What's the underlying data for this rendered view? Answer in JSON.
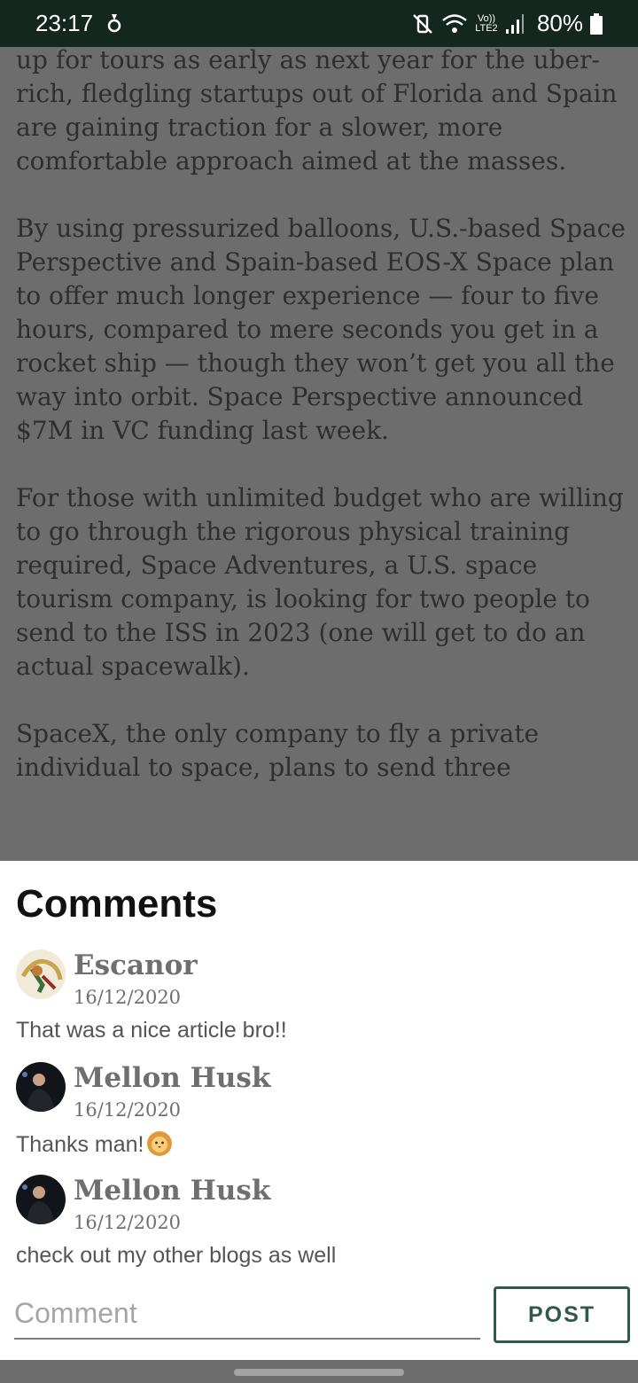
{
  "status_bar": {
    "time": "23:17",
    "network_label": "Vo)) LTE2",
    "battery": "80%"
  },
  "article": {
    "paragraphs": [
      "up for tours as early as next year for the uber-rich, fledgling startups out of Florida and Spain are gaining traction for a slower, more comfortable approach aimed at the masses.",
      "By using pressurized balloons, U.S.-based Space Perspective and Spain-based EOS-X Space plan to offer much longer experience — four to five hours, compared to mere seconds you get in a rocket ship — though they won’t get you all the way into orbit. Space Perspective announced $7M in VC funding last week.",
      "For those with unlimited budget who are willing to go through the rigorous physical training required, Space Adventures, a U.S. space tourism company, is looking for two people to send to the ISS in 2023 (one will get to do an actual spacewalk).",
      "SpaceX, the only company to fly a private individual to space, plans to send three"
    ]
  },
  "comments": {
    "title": "Comments",
    "items": [
      {
        "author": "Escanor",
        "date": "16/12/2020",
        "text": "That was a nice article bro!!",
        "avatar": "escanor-avatar-icon"
      },
      {
        "author": "Mellon Husk",
        "date": "16/12/2020",
        "text": "Thanks man!",
        "emoji": "lion-face-icon",
        "avatar": "speaker-avatar-icon"
      },
      {
        "author": "Mellon Husk",
        "date": "16/12/2020",
        "text": "check out my other blogs as well",
        "avatar": "speaker-avatar-icon"
      }
    ],
    "input_placeholder": "Comment",
    "post_label": "POST"
  },
  "colors": {
    "accent": "#2e5a47",
    "status_bar": "#13271f",
    "scrim": "#6d6d6d"
  }
}
